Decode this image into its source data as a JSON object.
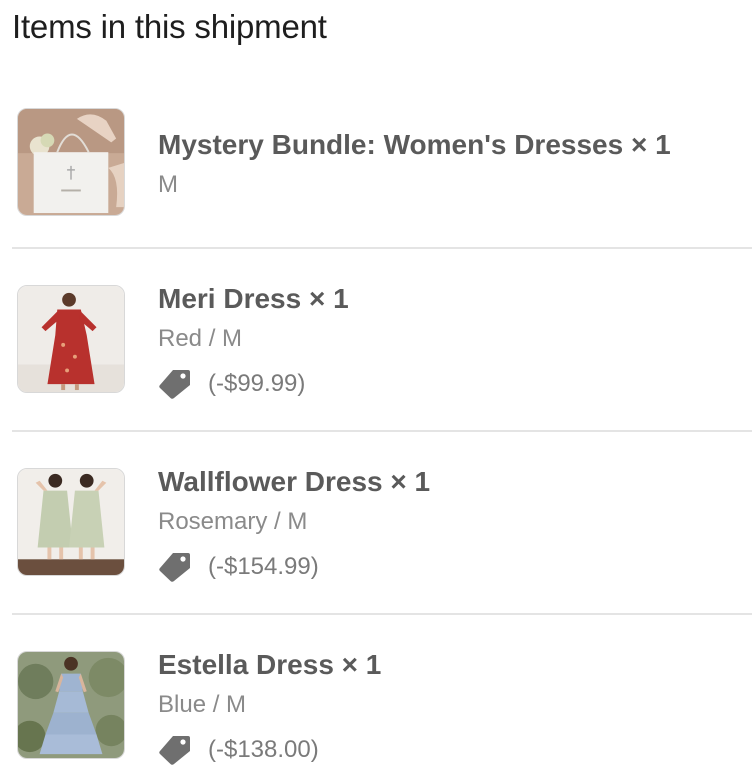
{
  "page": {
    "heading": "Items in this shipment"
  },
  "items": [
    {
      "title": "Mystery Bundle: Women's Dresses × 1",
      "variant": "M",
      "discount": null,
      "thumbnail_icon": "gift-bag-image"
    },
    {
      "title": "Meri Dress × 1",
      "variant": "Red / M",
      "discount": "(-$99.99)",
      "thumbnail_icon": "red-dress-image"
    },
    {
      "title": "Wallflower Dress × 1",
      "variant": "Rosemary / M",
      "discount": "(-$154.99)",
      "thumbnail_icon": "sage-dresses-image"
    },
    {
      "title": "Estella Dress × 1",
      "variant": "Blue / M",
      "discount": "(-$138.00)",
      "thumbnail_icon": "blue-dress-image"
    }
  ],
  "colors": {
    "title": "#5a5a5a",
    "variant": "#8a8a8a",
    "tag_icon": "#6f6f6f",
    "divider": "#e4e4e4"
  }
}
